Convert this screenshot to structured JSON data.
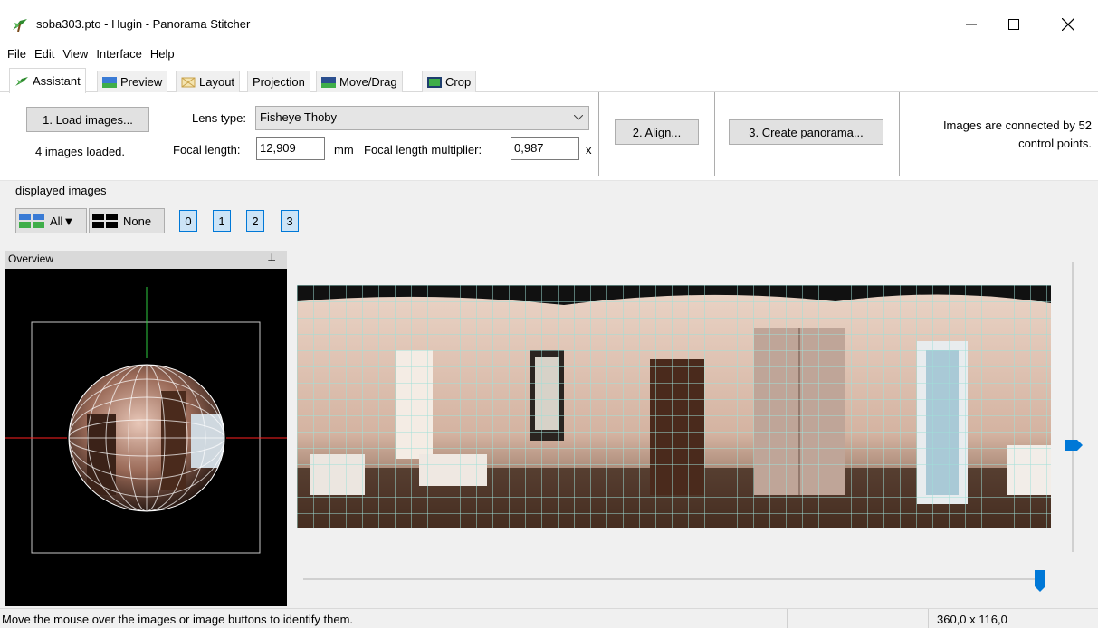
{
  "window": {
    "title": "soba303.pto - Hugin - Panorama Stitcher",
    "minimize": "—",
    "maximize": "☐",
    "close": "✕"
  },
  "menu": [
    "File",
    "Edit",
    "View",
    "Interface",
    "Help"
  ],
  "tabs": [
    {
      "label": "Assistant",
      "icon": "hugin-icon"
    },
    {
      "label": "Preview",
      "icon": "preview-icon"
    },
    {
      "label": "Layout",
      "icon": "layout-icon"
    },
    {
      "label": "Projection",
      "icon": ""
    },
    {
      "label": "Move/Drag",
      "icon": "move-icon"
    },
    {
      "label": "Crop",
      "icon": "crop-icon"
    }
  ],
  "assistant": {
    "load_button": "1. Load images...",
    "images_loaded": "4 images loaded.",
    "lens_type_label": "Lens type:",
    "lens_type_value": "Fisheye Thoby",
    "focal_length_label": "Focal length:",
    "focal_length_value": "12,909",
    "focal_length_unit": "mm",
    "multiplier_label": "Focal length multiplier:",
    "multiplier_value": "0,987",
    "multiplier_unit": "x",
    "align_button": "2. Align...",
    "create_button": "3. Create panorama...",
    "status_line1": "Images are connected by 52",
    "status_line2": "control points."
  },
  "displayed": {
    "heading": "displayed images",
    "all_label": "All▼",
    "none_label": "None",
    "image_buttons": [
      "0",
      "1",
      "2",
      "3"
    ]
  },
  "overview": {
    "title": "Overview",
    "pin": "ⵗ"
  },
  "statusbar": {
    "message": "Move the mouse over the images or image buttons to identify them.",
    "fov": "360,0 x 116,0"
  },
  "colors": {
    "accent": "#0078d7",
    "button_bg": "#e1e1e1",
    "grid_line": "#9fe0d8",
    "vertical_axis": "#2ecc40",
    "horizontal_axis": "#ff2020"
  }
}
